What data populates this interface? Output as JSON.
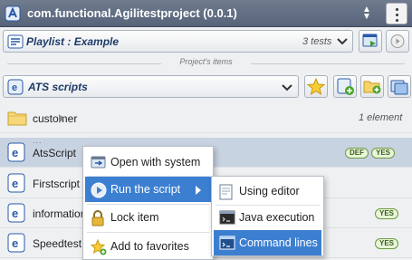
{
  "header": {
    "project_title": "com.functional.Agilitestproject (0.0.1)"
  },
  "playlist": {
    "name": "Playlist : Example",
    "count": "3 tests"
  },
  "section": {
    "label": "Project's items"
  },
  "scripts_selector": {
    "label": "ATS scripts"
  },
  "rows": [
    {
      "name": "customer",
      "meta": "1 element"
    },
    {
      "name": "AtsScript",
      "badges": [
        "DEF",
        "YES"
      ]
    },
    {
      "name": "Firstscript"
    },
    {
      "name": "information",
      "badges": [
        "YES"
      ]
    },
    {
      "name": "Speedtest",
      "badges": [
        "YES"
      ]
    }
  ],
  "context_menu": {
    "items": [
      "Open with system",
      "Run the script",
      "Lock item",
      "Add to favorites"
    ]
  },
  "submenu": {
    "items": [
      "Using editor",
      "Java execution",
      "Command lines"
    ]
  },
  "colors": {
    "accent": "#3c7fd1",
    "header": "#5f6c80",
    "badge_green": "#6c9a3f"
  }
}
